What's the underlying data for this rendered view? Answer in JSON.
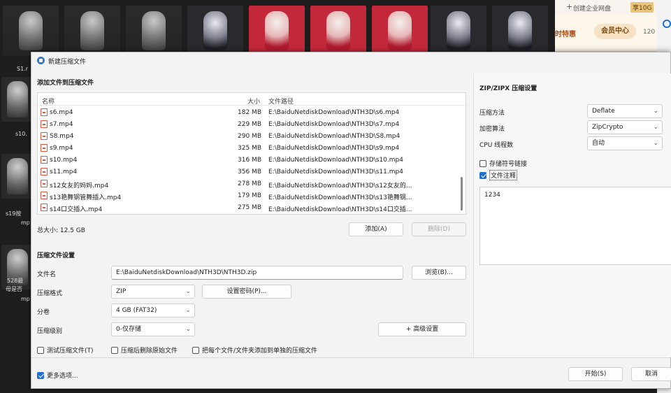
{
  "background": {
    "thumbs": [
      {
        "style": "gray",
        "label": ""
      },
      {
        "style": "gray",
        "label": ""
      },
      {
        "style": "gray",
        "label": ""
      },
      {
        "style": "dark",
        "label": ""
      },
      {
        "style": "red",
        "label": ""
      },
      {
        "style": "red",
        "label": ""
      },
      {
        "style": "red",
        "label": ""
      },
      {
        "style": "dark",
        "label": ""
      },
      {
        "style": "dark",
        "label": ""
      },
      {
        "style": "navy",
        "label": ""
      }
    ],
    "side_labels": [
      "S1.r",
      "s10.",
      "s19按",
      "mp",
      "528最",
      "母是否",
      "mp"
    ],
    "topbar": {
      "create_enterprise": "创建企业网盘",
      "quota_badge": "享10G",
      "promo_text": "时特惠",
      "vip_center": "会员中心",
      "count": "120"
    }
  },
  "dialog": {
    "title": "新建压缩文件",
    "add_files_title": "添加文件到压缩文件",
    "list": {
      "col_name": "名称",
      "col_size": "大小",
      "col_path": "文件路径",
      "rows": [
        {
          "name": "s6.mp4",
          "size": "182 MB",
          "path": "E:\\BaiduNetdiskDownload\\NTH3D\\s6.mp4"
        },
        {
          "name": "s7.mp4",
          "size": "229 MB",
          "path": "E:\\BaiduNetdiskDownload\\NTH3D\\s7.mp4"
        },
        {
          "name": "S8.mp4",
          "size": "290 MB",
          "path": "E:\\BaiduNetdiskDownload\\NTH3D\\S8.mp4"
        },
        {
          "name": "s9.mp4",
          "size": "325 MB",
          "path": "E:\\BaiduNetdiskDownload\\NTH3D\\s9.mp4"
        },
        {
          "name": "s10.mp4",
          "size": "316 MB",
          "path": "E:\\BaiduNetdiskDownload\\NTH3D\\s10.mp4"
        },
        {
          "name": "s11.mp4",
          "size": "356 MB",
          "path": "E:\\BaiduNetdiskDownload\\NTH3D\\s11.mp4"
        },
        {
          "name": "s12女友的妈妈.mp4",
          "size": "278 MB",
          "path": "E:\\BaiduNetdiskDownload\\NTH3D\\s12女友的..."
        },
        {
          "name": "s13艳舞钢管舞插入.mp4",
          "size": "179 MB",
          "path": "E:\\BaiduNetdiskDownload\\NTH3D\\s13艳舞钢..."
        },
        {
          "name": "s14口交插入.mp4",
          "size": "275 MB",
          "path": "E:\\BaiduNetdiskDownload\\NTH3D\\s14口交插..."
        }
      ]
    },
    "total_size": "总大小: 12.5 GB",
    "add_button": "添加(A)",
    "delete_button": "删除(D)",
    "settings_title": "压缩文件设置",
    "filename_label": "文件名",
    "filename_value": "E:\\BaiduNetdiskDownload\\NTH3D\\NTH3D.zip",
    "browse_button": "浏览(B)...",
    "format_label": "压缩格式",
    "format_value": "ZIP",
    "password_button": "设置密码(P)...",
    "split_label": "分卷",
    "split_value": "4 GB (FAT32)",
    "level_label": "压缩级别",
    "level_value": "0-仅存储",
    "advanced_button": "+ 高级设置",
    "check_test": "测试压缩文件(T)",
    "check_delete_source": "压缩后删除原始文件",
    "check_separate": "把每个文件/文件夹添加到单独的压缩文件",
    "more_options": "更多选项...",
    "start_button": "开始(S)",
    "cancel_button": "取消",
    "right": {
      "title": "ZIP/ZIPX 压缩设置",
      "method_label": "压缩方法",
      "method_value": "Deflate",
      "encrypt_label": "加密算法",
      "encrypt_value": "ZipCrypto",
      "threads_label": "CPU 线程数",
      "threads_value": "自动",
      "store_symlinks": "存储符号链接",
      "file_comment": "文件注释",
      "comment_text": "1234"
    }
  },
  "colors": {
    "accent": "#1f6fd1",
    "dialog_bg": "#f3f3f3",
    "file_icon": "#e0563e"
  }
}
